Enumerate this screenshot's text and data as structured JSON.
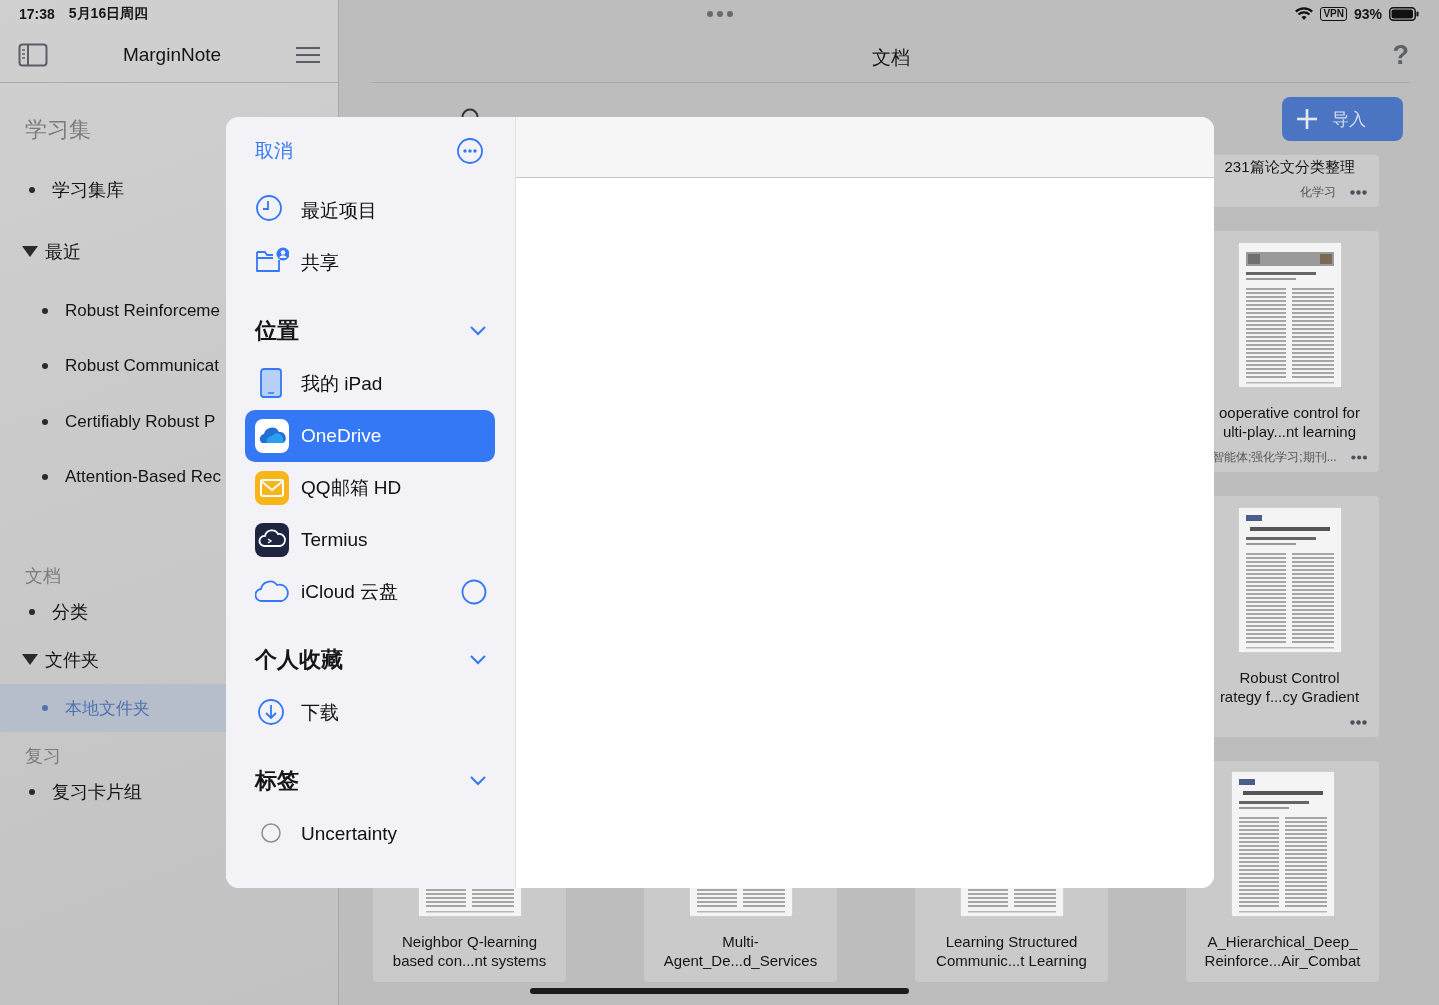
{
  "status_bar": {
    "time": "17:38",
    "date": "5月16日周四",
    "vpn": "VPN",
    "battery": "93%"
  },
  "sidebar": {
    "title": "MarginNote",
    "sections": [
      {
        "title": "学习集",
        "items": [
          {
            "label": "学习集库",
            "selected": false
          },
          {
            "label": "最近",
            "selected": false,
            "expanded": true,
            "children": [
              {
                "label": "Robust Reinforceme",
                "selected": false
              },
              {
                "label": "Robust Communicat",
                "selected": false
              },
              {
                "label": "Certifiably Robust P",
                "selected": false
              },
              {
                "label": "Attention-Based Rec",
                "selected": false
              }
            ]
          }
        ]
      },
      {
        "title": "文档",
        "items": [
          {
            "label": "分类",
            "selected": false
          },
          {
            "label": "文件夹",
            "selected": false,
            "expanded": true,
            "children": [
              {
                "label": "本地文件夹",
                "selected": true
              }
            ]
          }
        ]
      },
      {
        "title": "复习",
        "items": [
          {
            "label": "复习卡片组",
            "selected": false
          }
        ]
      }
    ]
  },
  "main": {
    "title": "文档",
    "help": "?",
    "import_button": "导入",
    "document_rows": [
      [
        {
          "title": "231篇论文分类整理",
          "tags": "化学习",
          "thumbnail": false,
          "menu": true
        }
      ],
      [
        {
          "title": "ooperative control for\nulti-play...nt learning",
          "tags": "智能体;强化学习;期刊...",
          "thumbnail": true,
          "menu": true
        }
      ],
      [
        {
          "title": "Robust Control\nrategy f...cy Gradient",
          "thumbnail": true,
          "menu": true
        }
      ],
      [
        {
          "title": "Neighbor Q-learning\nbased con...nt systems",
          "thumbnail": true,
          "menu": false
        },
        {
          "title": "Multi-\nAgent_De...d_Services",
          "thumbnail": true,
          "menu": false
        },
        {
          "title": "Learning Structured\nCommunic...t Learning",
          "thumbnail": true,
          "menu": false
        },
        {
          "title": "A_Hierarchical_Deep_\nReinforce...Air_Combat",
          "thumbnail": true,
          "menu": false
        }
      ]
    ]
  },
  "file_picker": {
    "cancel": "取消",
    "shortcuts": [
      {
        "label": "最近项目",
        "selected": false
      },
      {
        "label": "共享",
        "selected": false
      }
    ],
    "sections": [
      {
        "title": "位置",
        "expanded": true,
        "items": [
          {
            "label": "我的 iPad",
            "selected": false
          },
          {
            "label": "OneDrive",
            "selected": true
          },
          {
            "label": "QQ邮箱 HD",
            "selected": false
          },
          {
            "label": "Termius",
            "selected": false
          },
          {
            "label": "iCloud 云盘",
            "selected": false,
            "checked": false
          }
        ]
      },
      {
        "title": "个人收藏",
        "expanded": true,
        "items": [
          {
            "label": "下载",
            "selected": false
          }
        ]
      },
      {
        "title": "标签",
        "expanded": true,
        "items": [
          {
            "label": "Uncertainty",
            "selected": false
          }
        ]
      }
    ]
  }
}
